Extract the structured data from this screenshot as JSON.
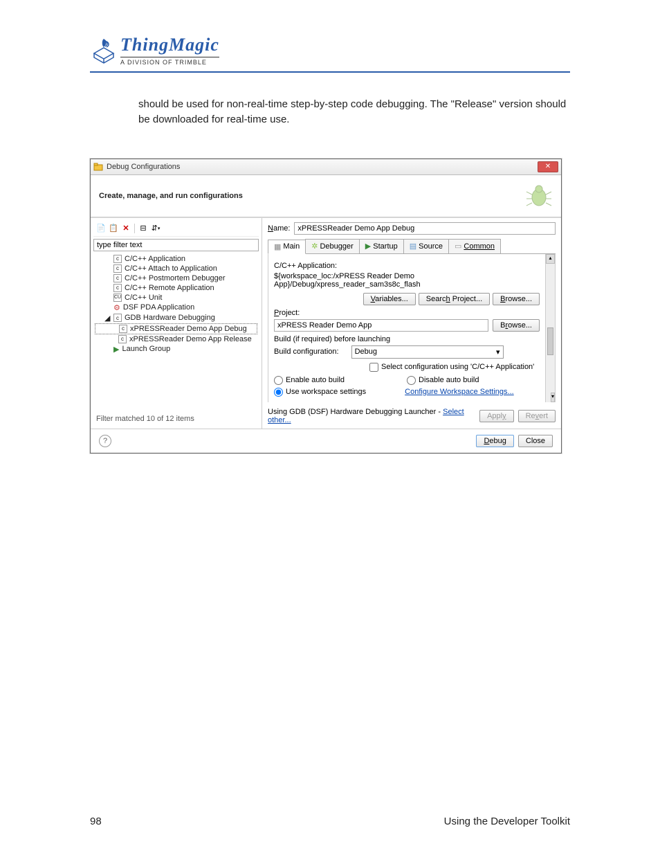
{
  "page": {
    "number": "98",
    "footer_right": "Using the Developer Toolkit",
    "body_text": "should be used for non-real-time step-by-step code debugging. The \"Release\" version should be downloaded for real-time use."
  },
  "logo": {
    "name": "ThingMagic",
    "sub": "A DIVISION OF TRIMBLE"
  },
  "dialog": {
    "title": "Debug Configurations",
    "subtitle": "Create, manage, and run configurations",
    "filter_placeholder": "type filter text",
    "filter_status": "Filter matched 10 of 12 items",
    "name_label": "Name:",
    "name_value": "xPRESSReader Demo App Debug",
    "tabs": {
      "main": "Main",
      "debugger": "Debugger",
      "startup": "Startup",
      "source": "Source",
      "common": "Common"
    },
    "app_label": "C/C++ Application:",
    "app_value": "${workspace_loc:/xPRESS Reader Demo App}/Debug/xpress_reader_sam3s8c_flash",
    "buttons": {
      "variables": "Variables...",
      "search": "Search Project...",
      "browse": "Browse..."
    },
    "project_label": "Project:",
    "project_value": "xPRESS Reader Demo App",
    "build_before": "Build (if required) before launching",
    "build_config_label": "Build configuration:",
    "build_config_value": "Debug",
    "select_config_app": "Select configuration using 'C/C++ Application'",
    "enable_auto": "Enable auto build",
    "disable_auto": "Disable auto build",
    "use_workspace": "Use workspace settings",
    "configure_ws": "Configure Workspace Settings...",
    "launcher_text": "Using GDB (DSF) Hardware Debugging Launcher - ",
    "launcher_select": "Select other...",
    "apply": "Apply",
    "revert": "Revert",
    "debug": "Debug",
    "close": "Close"
  },
  "tree": [
    {
      "label": "C/C++ Application",
      "indent": 1,
      "icon": "c"
    },
    {
      "label": "C/C++ Attach to Application",
      "indent": 1,
      "icon": "c"
    },
    {
      "label": "C/C++ Postmortem Debugger",
      "indent": 1,
      "icon": "c"
    },
    {
      "label": "C/C++ Remote Application",
      "indent": 1,
      "icon": "c"
    },
    {
      "label": "C/C++ Unit",
      "indent": 1,
      "icon": "cu"
    },
    {
      "label": "DSF PDA Application",
      "indent": 1,
      "icon": "gear"
    },
    {
      "label": "GDB Hardware Debugging",
      "indent": 1,
      "icon": "c",
      "expand": true
    },
    {
      "label": "xPRESSReader Demo App Debug",
      "indent": 2,
      "icon": "c",
      "selected": true
    },
    {
      "label": "xPRESSReader Demo App Release",
      "indent": 2,
      "icon": "c"
    },
    {
      "label": "Launch Group",
      "indent": 1,
      "icon": "play"
    }
  ]
}
